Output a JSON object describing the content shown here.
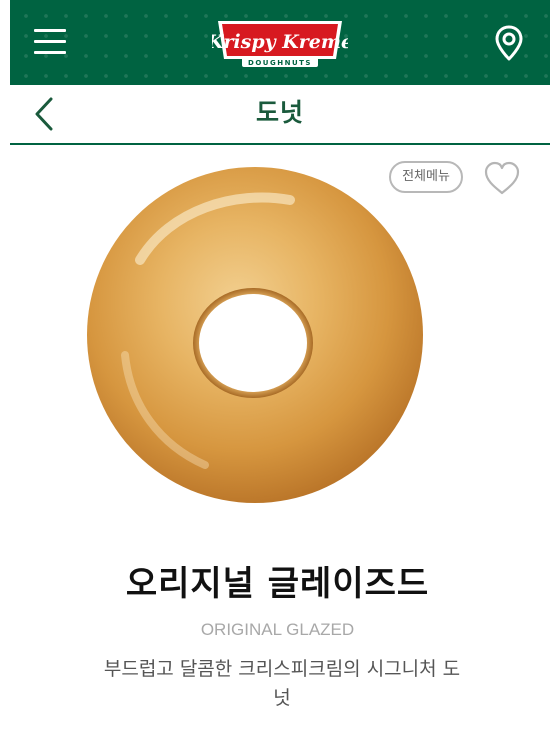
{
  "header": {
    "brand_logo": {
      "name": "Krispy Kreme",
      "sub": "DOUGHNUTS",
      "icon": "krispy-kreme-logo"
    },
    "menu_icon": "hamburger-menu-icon",
    "location_icon": "location-pin-icon",
    "brand_color": "#006341"
  },
  "subheader": {
    "back_icon": "chevron-left-icon",
    "title": "도넛"
  },
  "product": {
    "full_menu_label": "전체메뉴",
    "favorite_icon": "heart-icon",
    "image": "original-glazed-donut",
    "name_ko": "오리지널 글레이즈드",
    "name_en": "ORIGINAL GLAZED",
    "description": "부드럽고 달콤한 크리스피크림의 시그니처 도넛"
  }
}
